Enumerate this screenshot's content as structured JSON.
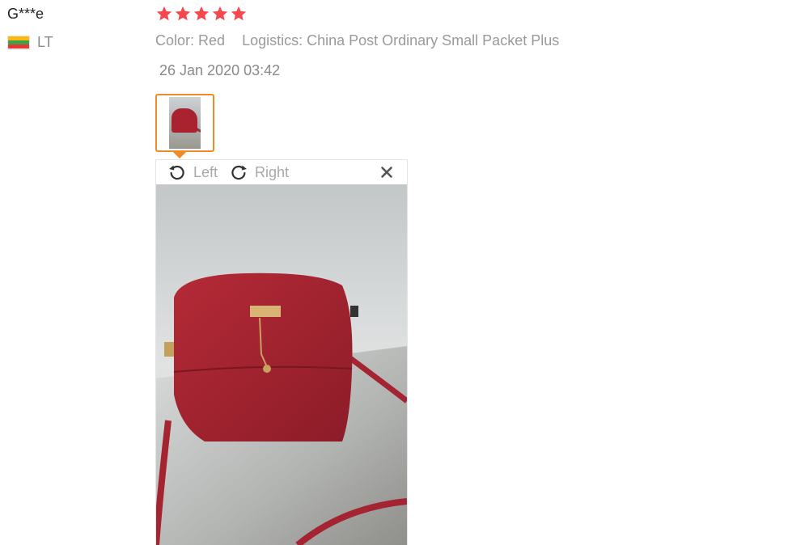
{
  "review": {
    "username": "G***e",
    "country_code": "LT",
    "rating": 5,
    "color_label": "Color: Red",
    "logistics_label": "Logistics: China Post Ordinary Small Packet Plus",
    "date": "26 Jan 2020 03:42"
  },
  "viewer": {
    "rotate_left_label": "Left",
    "rotate_right_label": "Right"
  },
  "icons": {
    "star": "star-icon",
    "flag": "lithuania-flag-icon",
    "rotate_left": "rotate-left-icon",
    "rotate_right": "rotate-right-icon",
    "close": "close-icon"
  },
  "colors": {
    "star": "#f5474d",
    "thumb_border": "#f08a24",
    "meta_text": "#9a9a9a",
    "bag": "#a8222f"
  }
}
